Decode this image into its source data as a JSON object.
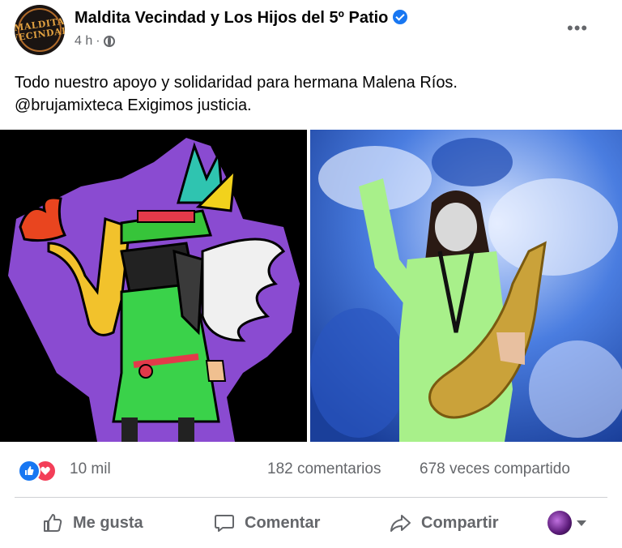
{
  "post": {
    "page_name": "Maldita Vecindad y Los Hijos del 5º Patio",
    "avatar_text_line1": "MALDITA",
    "avatar_text_line2": "VECINDAD",
    "time": "4 h",
    "time_separator": "·",
    "privacy_icon": "globe-icon",
    "more_label": "•••",
    "text_line1": "Todo nuestro apoyo y solidaridad para hermana Malena Ríos.",
    "text_line2": "@brujamixteca Exigimos justicia."
  },
  "reactions": {
    "icons": [
      "like-icon",
      "love-icon"
    ],
    "count": "10 mil",
    "comments": "182 comentarios",
    "shares": "678 veces compartido"
  },
  "actions": {
    "like": "Me gusta",
    "comment": "Comentar",
    "share": "Compartir"
  },
  "colors": {
    "facebook_blue": "#1877f2",
    "love_red": "#f33e58",
    "secondary_text": "#65676b",
    "divider": "#ced0d4"
  }
}
